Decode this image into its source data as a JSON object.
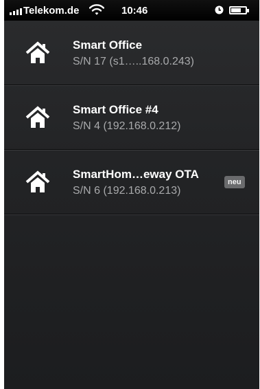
{
  "status_bar": {
    "carrier": "Telekom.de",
    "time": "10:46",
    "signal_icon": "signal-bars-icon",
    "wifi_icon": "wifi-icon",
    "alarm_icon": "alarm-clock-icon",
    "battery_icon": "battery-icon",
    "battery_level": 0.7
  },
  "devices": [
    {
      "name": "Smart Office",
      "serial": "S/N 17 (s1…..168.0.243)",
      "icon": "home-icon",
      "badge": ""
    },
    {
      "name": "Smart Office #4",
      "serial": "S/N 4 (192.168.0.212)",
      "icon": "home-icon",
      "badge": ""
    },
    {
      "name": "SmartHom…eway OTA",
      "serial": "S/N 6 (192.168.0.213)",
      "icon": "home-icon",
      "badge": "neu"
    }
  ],
  "colors": {
    "background": "#232426",
    "title_text": "#ffffff",
    "subtitle_text": "#a9aaac",
    "badge_background": "#6a6b6d"
  }
}
